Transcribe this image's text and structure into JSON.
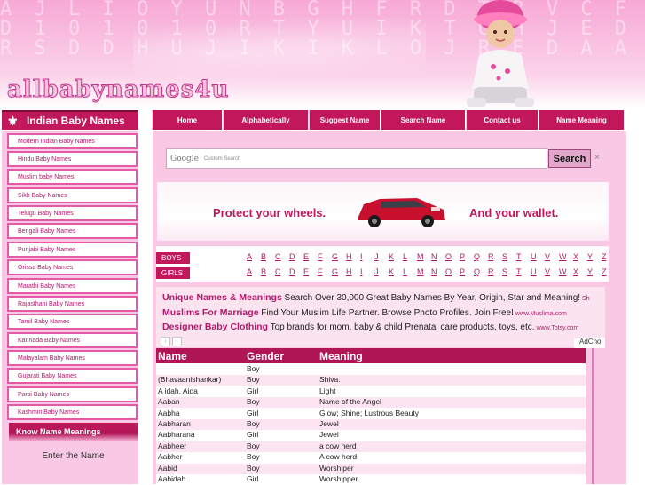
{
  "site": {
    "logo_text": "allbabynames4u",
    "header_letters": [
      "A J L I O Y U N B G H F R D T B V C F G P G P A O 1 1 0 1 1",
      "D 1 0 1 0 1 0 R T Y U I K T G H J E D E X 3 W D V C D V D",
      "R S D D H U J I K I K L O J R E D A A W K D L R A S F N B"
    ]
  },
  "sidebar": {
    "title": "Indian Baby Names",
    "items": [
      {
        "label": "Modern Indian Baby Names"
      },
      {
        "label": "Hindu Baby Names"
      },
      {
        "label": "Muslim baby Names"
      },
      {
        "label": "Sikh Baby Names"
      },
      {
        "label": "Telugu Baby Names"
      },
      {
        "label": "Bengali Baby Names"
      },
      {
        "label": "Punjabi Baby Names"
      },
      {
        "label": "Orissa Baby Names"
      },
      {
        "label": "Marathi Baby Names"
      },
      {
        "label": "Rajasthani Baby Names"
      },
      {
        "label": "Tamil Baby Names"
      },
      {
        "label": "Kannada Baby Names"
      },
      {
        "label": "Malayalam Baby Names"
      },
      {
        "label": "Gujarati Baby Names"
      },
      {
        "label": "Parsi Baby Names"
      },
      {
        "label": "Kashmiri Baby Names"
      }
    ],
    "know_title": "Know Name Meanings",
    "enter_label": "Enter the Name"
  },
  "nav": [
    {
      "label": "Home"
    },
    {
      "label": "Alphabetically"
    },
    {
      "label": "Suggest Name"
    },
    {
      "label": "Search Name"
    },
    {
      "label": "Contact us"
    },
    {
      "label": "Name Meaning"
    }
  ],
  "search": {
    "google_label": "Google",
    "placeholder": "Custom Search",
    "button_label": "Search",
    "close_label": "×"
  },
  "ad_banner": {
    "left_text": "Protect your wheels.",
    "right_text": "And your wallet."
  },
  "alphabet": {
    "boys_label": "BOYS",
    "girls_label": "GIRLS",
    "letters": [
      "A",
      "B",
      "C",
      "D",
      "E",
      "F",
      "G",
      "H",
      "I",
      "J",
      "K",
      "L",
      "M",
      "N",
      "O",
      "P",
      "Q",
      "R",
      "S",
      "T",
      "U",
      "V",
      "W",
      "X",
      "Y",
      "Z"
    ]
  },
  "ads": [
    {
      "title": "Unique Names & Meanings",
      "text": " Search Over 30,000 Great Baby Names By Year, Origin, Star and Meaning!",
      "url": " Sh"
    },
    {
      "title": "Muslims For Marriage",
      "text": " Find Your Muslim Life Partner. Browse Photo Profiles. Join Free!",
      "url": " www.Muslima.com"
    },
    {
      "title": "Designer Baby Clothing",
      "text": " Top brands for mom, baby & child Prenatal care products, toys, etc.",
      "url": " www.Totsy.com"
    }
  ],
  "ad_choices": "AdChoi",
  "ad_arrows": [
    "‹",
    "›"
  ],
  "table": {
    "headers": {
      "name": "Name",
      "gender": "Gender",
      "meaning": "Meaning"
    },
    "rows": [
      {
        "name": "",
        "gender": "Boy",
        "meaning": ""
      },
      {
        "name": "(Bhavaanishankar)",
        "gender": "Boy",
        "meaning": "Shiva."
      },
      {
        "name": "A idah, Aida",
        "gender": "Girl",
        "meaning": "Light"
      },
      {
        "name": "Aaban",
        "gender": "Boy",
        "meaning": "Name of the Angel"
      },
      {
        "name": "Aabha",
        "gender": "Girl",
        "meaning": "Glow; Shine; Lustrous Beauty"
      },
      {
        "name": "Aabharan",
        "gender": "Boy",
        "meaning": "Jewel"
      },
      {
        "name": "Aabharana",
        "gender": "Girl",
        "meaning": "Jewel"
      },
      {
        "name": "Aabheer",
        "gender": "Boy",
        "meaning": "a cow herd"
      },
      {
        "name": "Aabher",
        "gender": "Boy",
        "meaning": "A cow herd"
      },
      {
        "name": "Aabid",
        "gender": "Boy",
        "meaning": "Worshiper"
      },
      {
        "name": "Aabidah",
        "gender": "Girl",
        "meaning": "Worshipper."
      }
    ]
  }
}
